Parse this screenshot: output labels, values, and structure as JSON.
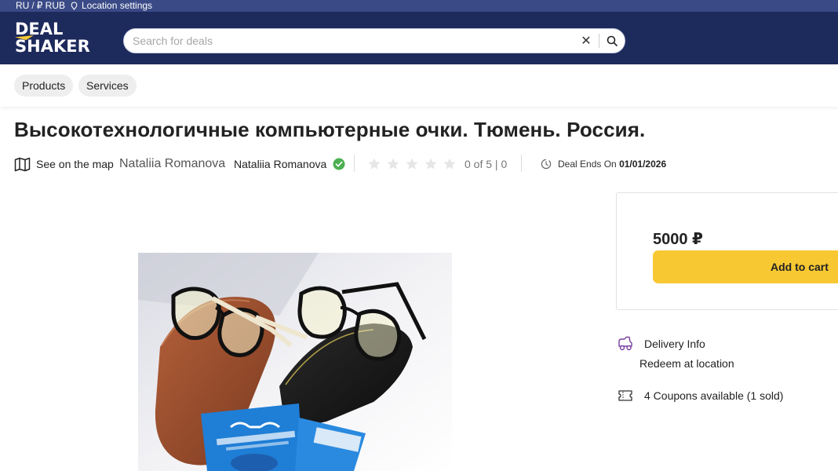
{
  "topbar": {
    "lang": "RU",
    "separator": "/",
    "currency": "₽ RUB",
    "location": "Location settings"
  },
  "header": {
    "logo_line1": "DEAL",
    "logo_line2": "SHAKER",
    "search_placeholder": "Search for deals",
    "search_value": "",
    "clear_symbol": "✕"
  },
  "categories": [
    {
      "label": "Products"
    },
    {
      "label": "Services"
    }
  ],
  "product": {
    "title": "Высокотехнологичные компьютерные очки. Тюмень. Россия.",
    "map_link": "See on the map",
    "seller_name_large": "Nataliia Romanova",
    "seller_name_small": "Nataliia Romanova",
    "rating": {
      "value": 0,
      "max": 5,
      "text": "0 of 5 | 0"
    },
    "deal_ends_label": "Deal Ends On",
    "deal_ends_date": "01/01/2026"
  },
  "purchase": {
    "price": "5000 ₽",
    "add_to_cart": "Add to cart"
  },
  "info": {
    "delivery_label": "Delivery Info",
    "delivery_value": "Redeem at location",
    "coupons": "4 Coupons available (1 sold)"
  },
  "colors": {
    "header_bg": "#1d2a5c",
    "topbar_bg": "#3a4a86",
    "accent_yellow": "#f8c832",
    "verified_green": "#4caf50",
    "delivery_icon": "#7b3fa0"
  },
  "icons": [
    "map-icon",
    "verified-check-icon",
    "star-icon",
    "clock-icon",
    "search-icon",
    "close-icon",
    "delivery-icon",
    "coupon-icon",
    "location-pin-icon"
  ]
}
